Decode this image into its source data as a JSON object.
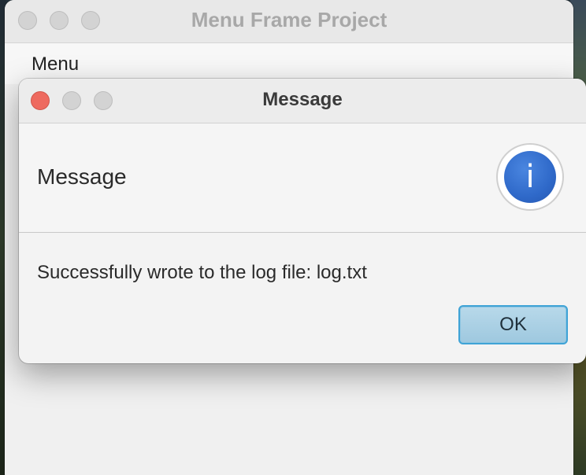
{
  "main_window": {
    "title": "Menu Frame Project",
    "menubar": {
      "items": [
        {
          "label": "Menu"
        }
      ]
    }
  },
  "dialog": {
    "title": "Message",
    "header": "Message",
    "icon": "info-icon",
    "icon_glyph": "i",
    "message": "Successfully wrote to the log file: log.txt",
    "ok_label": "OK"
  },
  "colors": {
    "close_button": "#ee6a5f",
    "info_icon": "#2f69c9",
    "ok_button_border": "#3fa3d6",
    "ok_button_fill": "#a9d0e4"
  }
}
